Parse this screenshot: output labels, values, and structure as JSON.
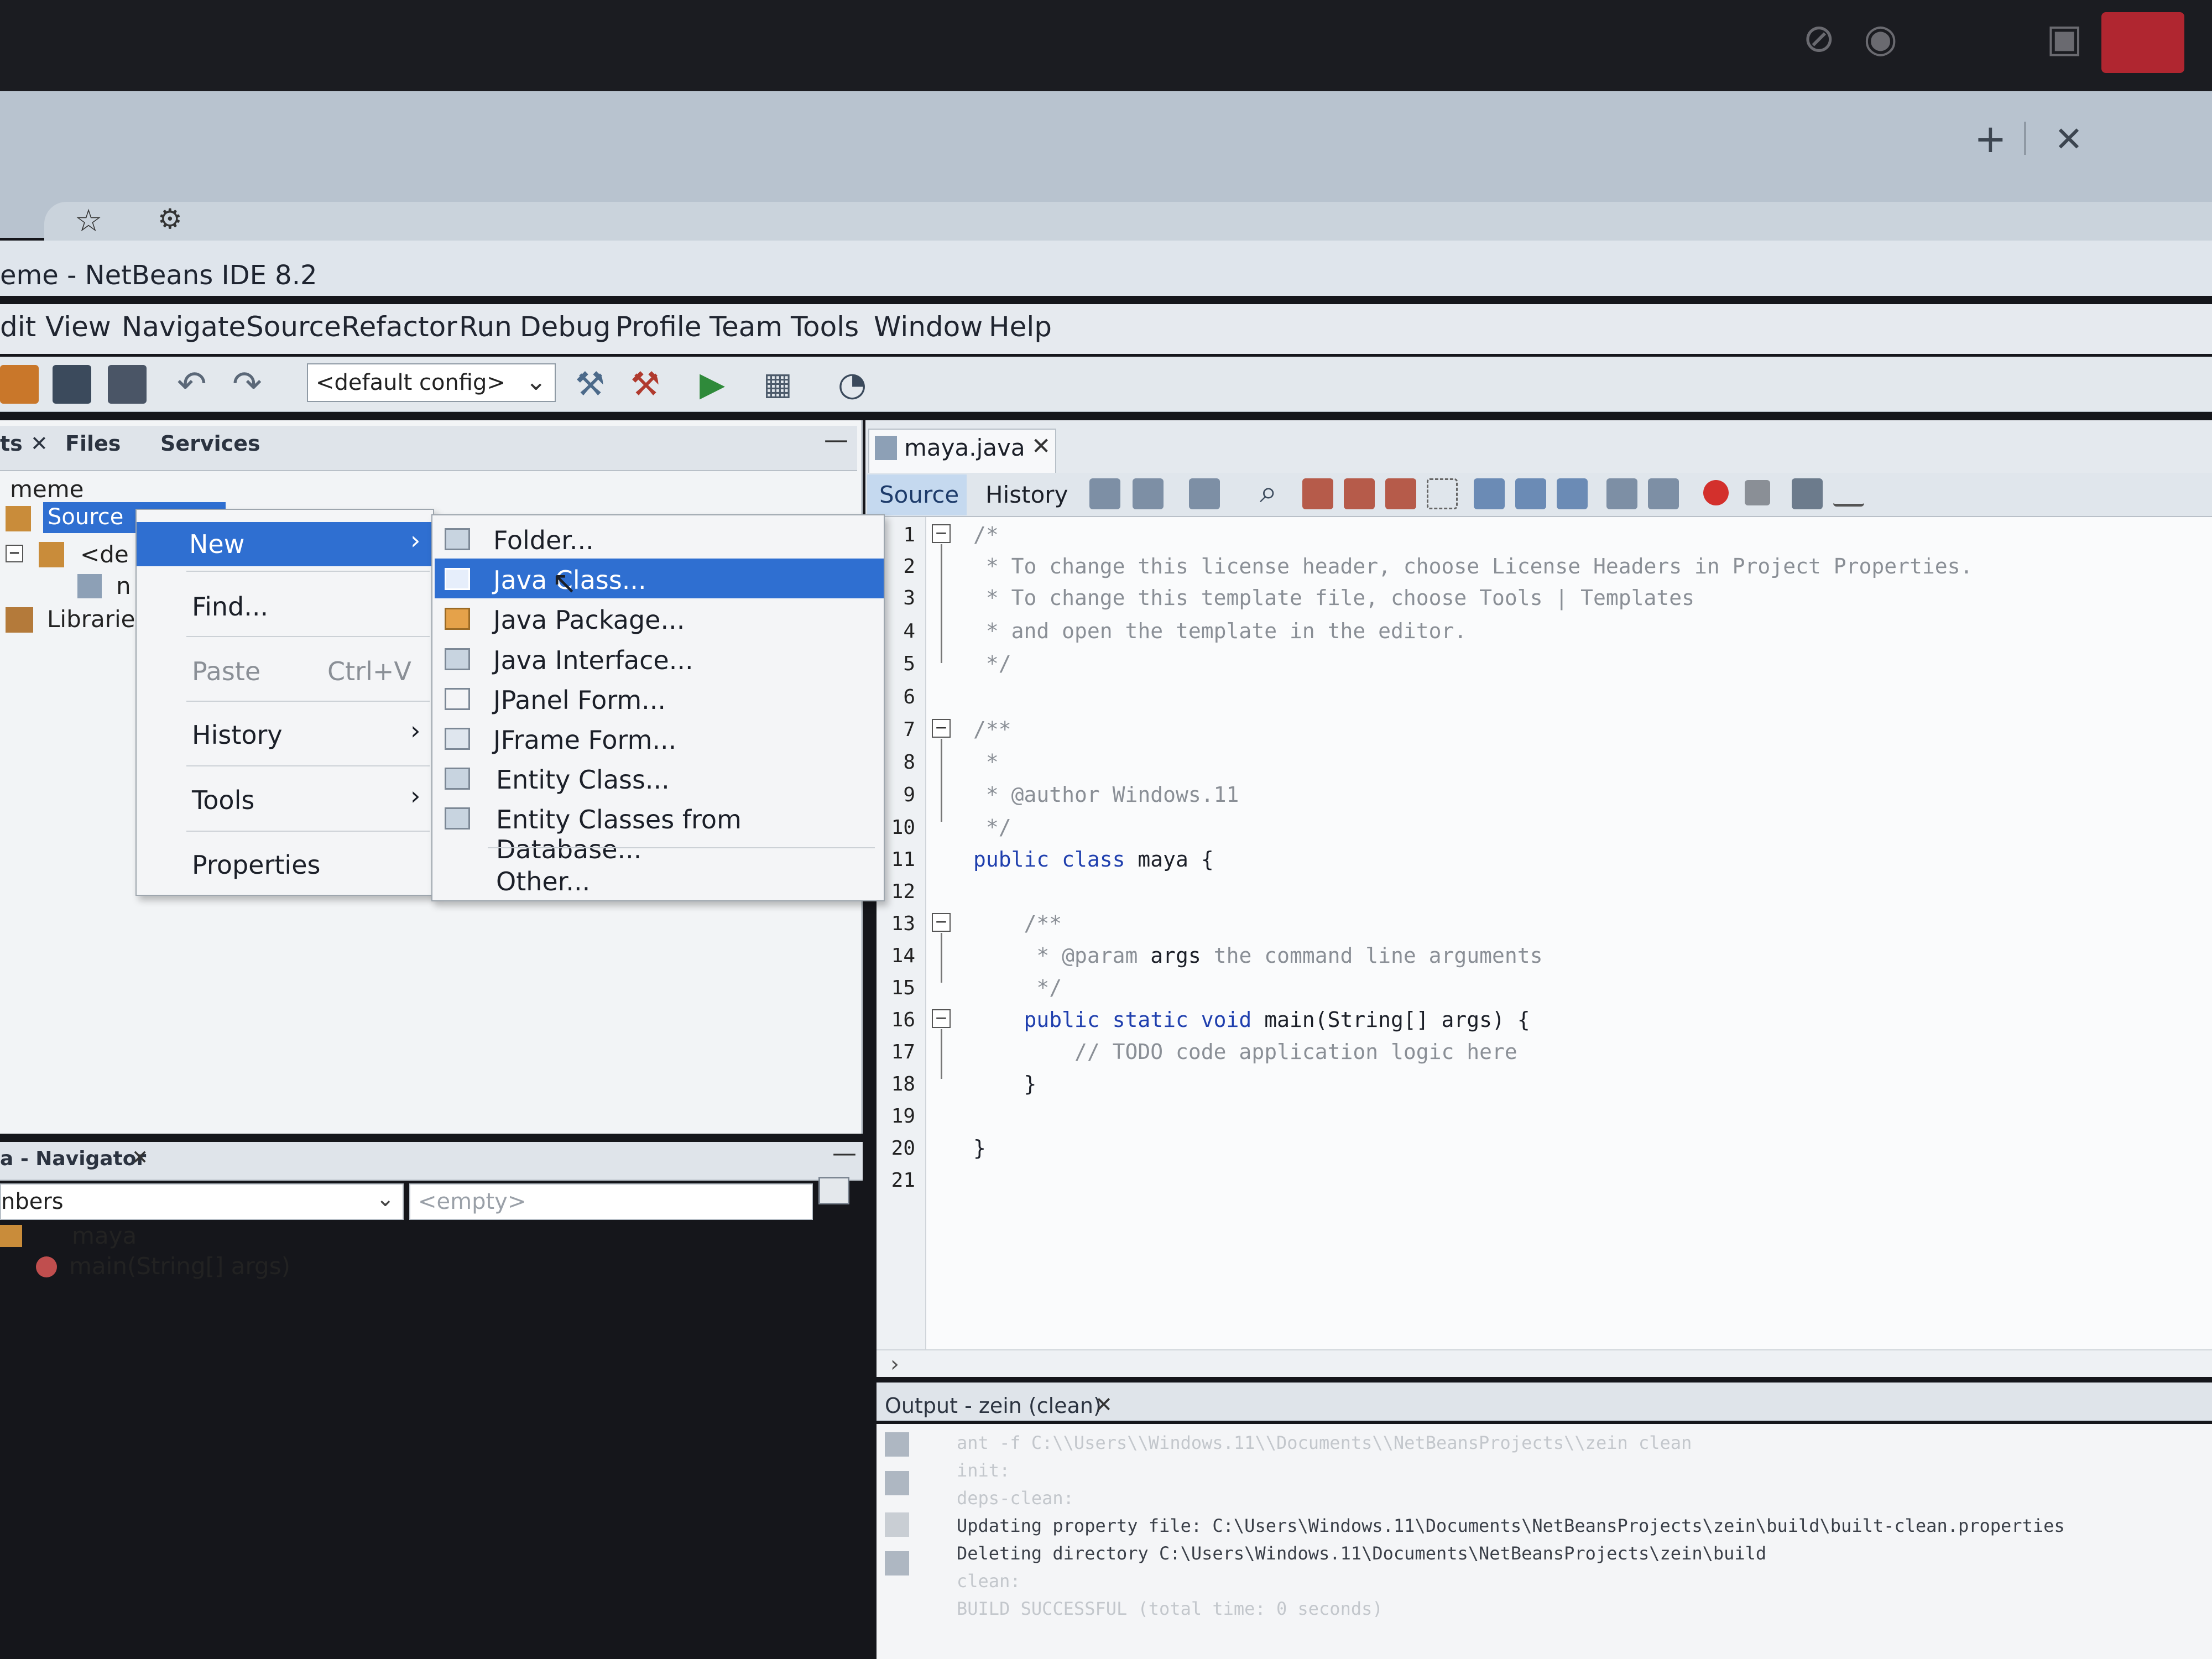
{
  "window": {
    "title": "eme - NetBeans IDE 8.2"
  },
  "menubar": [
    "dit",
    "View",
    "Navigate",
    "Source",
    "Refactor",
    "Run",
    "Debug",
    "Profile",
    "Team",
    "Tools",
    "Window",
    "Help"
  ],
  "toolbar": {
    "config": "<default config>"
  },
  "projects": {
    "tabs": [
      "ts",
      "Files",
      "Services"
    ],
    "root": "meme",
    "selected": "Source",
    "default_pkg": "<de",
    "sub_item": "n",
    "libraries": "Librarie"
  },
  "context_menu": {
    "new": "New",
    "find": "Find...",
    "paste": "Paste",
    "paste_shortcut": "Ctrl+V",
    "history": "History",
    "tools": "Tools",
    "properties": "Properties"
  },
  "submenu": {
    "folder": "Folder...",
    "java_class": "Java Class...",
    "java_package": "Java Package...",
    "java_interface": "Java Interface...",
    "jpanel": "JPanel Form...",
    "jframe": "JFrame Form...",
    "entity": "Entity Class...",
    "entity_db": "Entity Classes from Database...",
    "other": "Other..."
  },
  "navigator": {
    "title": "a - Navigator",
    "filter": "nbers",
    "empty": "<empty>",
    "class": "maya",
    "method": "main(String[] args)"
  },
  "editor": {
    "tab": "maya.java",
    "source_btn": "Source",
    "history_btn": "History",
    "line_numbers": [
      "1",
      "2",
      "3",
      "4",
      "5",
      "6",
      "7",
      "8",
      "9",
      "10",
      "11",
      "12",
      "13",
      "14",
      "15",
      "16",
      "17",
      "18",
      "19",
      "20",
      "21"
    ],
    "code": {
      "l1": "/*",
      "l2": " * To change this license header, choose License Headers in Project Properties.",
      "l3": " * To change this template file, choose Tools | Templates",
      "l4": " * and open the template in the editor.",
      "l5": " */",
      "l7": "/**",
      "l8": " *",
      "l9": " * @author Windows.11",
      "l10": " */",
      "l11_kw": "public class",
      "l11_rest": " maya {",
      "l13": "    /**",
      "l14_a": "     * @param ",
      "l14_b": "args",
      "l14_c": " the command line arguments",
      "l15": "     */",
      "l16_kw": "    public static void ",
      "l16_rest": "main(String[] args) {",
      "l17": "        // TODO code application logic here",
      "l18": "    }",
      "l20": "}"
    }
  },
  "output": {
    "title": "Output - zein (clean)",
    "lines": {
      "o1": "ant -f C:\\\\Users\\\\Windows.11\\\\Documents\\\\NetBeansProjects\\\\zein clean",
      "o2": "init:",
      "o3": "deps-clean:",
      "o4": "Updating property file: C:\\Users\\Windows.11\\Documents\\NetBeansProjects\\zein\\build\\built-clean.properties",
      "o5": "Deleting directory C:\\Users\\Windows.11\\Documents\\NetBeansProjects\\zein\\build",
      "o6": "clean:",
      "o7": "BUILD SUCCESSFUL (total time: 0 seconds)"
    }
  },
  "colors": {
    "selection": "#2f6fd1",
    "keyword": "#1f3fae",
    "comment": "#8a8f96"
  }
}
